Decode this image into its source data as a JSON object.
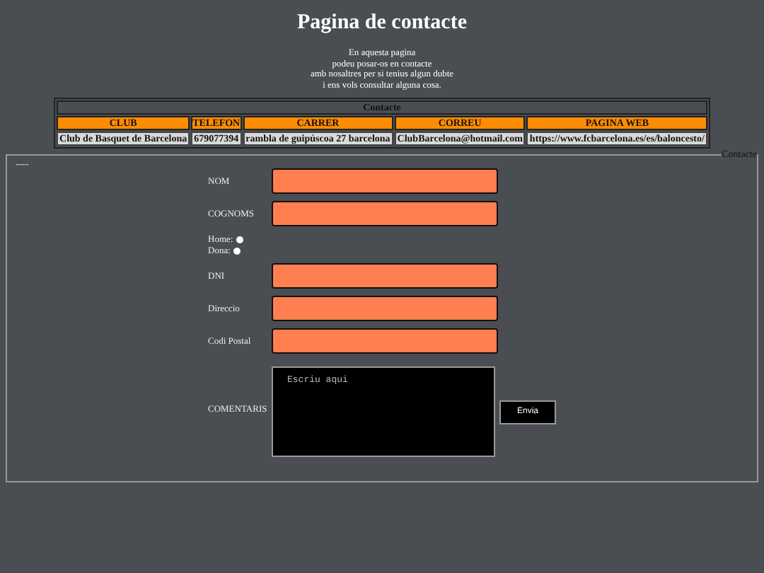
{
  "title": "Pagina de contacte",
  "intro": [
    "En aquesta pagina",
    "podeu posar-os en contacte",
    "amb nosaltres per si tenius algun dubte",
    "i ens vols consultar alguna cosa."
  ],
  "table": {
    "caption": "Contacte",
    "columns": [
      "CLUB",
      "TELEFON",
      "CARRER",
      "CORREU",
      "PAGINA WEB"
    ],
    "rows": [
      [
        "Club de Basquet de Barcelona",
        "679077394",
        "rambla de guipúscoa 27 barcelona",
        "ClubBarcelona@hotmail.com",
        "https://www.fcbarcelona.es/es/baloncesto/"
      ]
    ]
  },
  "form": {
    "legend": "Contacte",
    "note": "----",
    "fields": [
      {
        "kind": "text",
        "label": "NOM"
      },
      {
        "kind": "text",
        "label": "COGNOMS"
      },
      {
        "kind": "radios",
        "options": [
          {
            "label": "Home:",
            "selected": false
          },
          {
            "label": "Dona:",
            "selected": false
          }
        ]
      },
      {
        "kind": "text",
        "label": "DNI"
      },
      {
        "kind": "text",
        "label": "Direccio"
      },
      {
        "kind": "text",
        "label": "Codi Postal"
      },
      {
        "kind": "textarea",
        "label": "COMENTARIS",
        "placeholder": "Escriu aqui"
      }
    ],
    "submit": "Envia"
  }
}
